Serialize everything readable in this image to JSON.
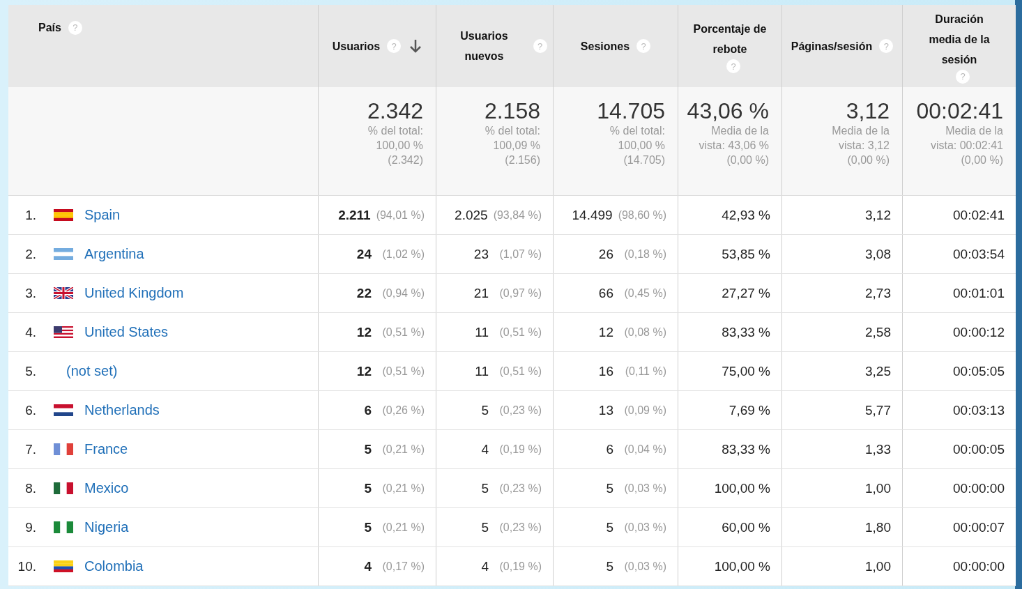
{
  "table": {
    "columns": [
      {
        "label": "País",
        "help": "?"
      },
      {
        "label": "Usuarios",
        "help": "?",
        "sorted": true
      },
      {
        "label": "Usuarios nuevos",
        "help": "?"
      },
      {
        "label": "Sesiones",
        "help": "?"
      },
      {
        "label": "Porcentaje de rebote",
        "help": "?"
      },
      {
        "label": "Páginas/sesión",
        "help": "?"
      },
      {
        "label": "Duración media de la sesión",
        "help": "?"
      }
    ],
    "totals": [
      {
        "value": "2.342",
        "note": [
          "% del total:",
          "100,00 %",
          "(2.342)"
        ]
      },
      {
        "value": "2.158",
        "note": [
          "% del total:",
          "100,09 %",
          "(2.156)"
        ]
      },
      {
        "value": "14.705",
        "note": [
          "% del total:",
          "100,00 %",
          "(14.705)"
        ]
      },
      {
        "value": "43,06 %",
        "note": [
          "Media de la",
          "vista: 43,06 %",
          "(0,00 %)"
        ]
      },
      {
        "value": "3,12",
        "note": [
          "Media de la",
          "vista: 3,12",
          "(0,00 %)"
        ]
      },
      {
        "value": "00:02:41",
        "note": [
          "Media de la",
          "vista: 00:02:41",
          "(0,00 %)"
        ]
      }
    ],
    "rows": [
      {
        "cells": [
          {
            "rank": "1.",
            "country": "Spain",
            "flag": {
              "kind": "es"
            }
          },
          {
            "value": "2.211",
            "share": "(94,01 %)"
          },
          {
            "value": "2.025",
            "share": "(93,84 %)"
          },
          {
            "value": "14.499",
            "share": "(98,60 %)"
          },
          {
            "value": "42,93 %"
          },
          {
            "value": "3,12"
          },
          {
            "value": "00:02:41"
          }
        ]
      },
      {
        "cells": [
          {
            "rank": "2.",
            "country": "Argentina",
            "flag": {
              "kind": "ar"
            }
          },
          {
            "value": "24",
            "share": "(1,02 %)"
          },
          {
            "value": "23",
            "share": "(1,07 %)"
          },
          {
            "value": "26",
            "share": "(0,18 %)"
          },
          {
            "value": "53,85 %"
          },
          {
            "value": "3,08"
          },
          {
            "value": "00:03:54"
          }
        ]
      },
      {
        "cells": [
          {
            "rank": "3.",
            "country": "United Kingdom",
            "flag": {
              "kind": "gb"
            }
          },
          {
            "value": "22",
            "share": "(0,94 %)"
          },
          {
            "value": "21",
            "share": "(0,97 %)"
          },
          {
            "value": "66",
            "share": "(0,45 %)"
          },
          {
            "value": "27,27 %"
          },
          {
            "value": "2,73"
          },
          {
            "value": "00:01:01"
          }
        ]
      },
      {
        "cells": [
          {
            "rank": "4.",
            "country": "United States",
            "flag": {
              "kind": "us"
            }
          },
          {
            "value": "12",
            "share": "(0,51 %)"
          },
          {
            "value": "11",
            "share": "(0,51 %)"
          },
          {
            "value": "12",
            "share": "(0,08 %)"
          },
          {
            "value": "83,33 %"
          },
          {
            "value": "2,58"
          },
          {
            "value": "00:00:12"
          }
        ]
      },
      {
        "cells": [
          {
            "rank": "5.",
            "country": "(not set)"
          },
          {
            "value": "12",
            "share": "(0,51 %)"
          },
          {
            "value": "11",
            "share": "(0,51 %)"
          },
          {
            "value": "16",
            "share": "(0,11 %)"
          },
          {
            "value": "75,00 %"
          },
          {
            "value": "3,25"
          },
          {
            "value": "00:05:05"
          }
        ]
      },
      {
        "cells": [
          {
            "rank": "6.",
            "country": "Netherlands",
            "flag": {
              "kind": "nl"
            }
          },
          {
            "value": "6",
            "share": "(0,26 %)"
          },
          {
            "value": "5",
            "share": "(0,23 %)"
          },
          {
            "value": "13",
            "share": "(0,09 %)"
          },
          {
            "value": "7,69 %"
          },
          {
            "value": "5,77"
          },
          {
            "value": "00:03:13"
          }
        ]
      },
      {
        "cells": [
          {
            "rank": "7.",
            "country": "France",
            "flag": {
              "kind": "fr"
            }
          },
          {
            "value": "5",
            "share": "(0,21 %)"
          },
          {
            "value": "4",
            "share": "(0,19 %)"
          },
          {
            "value": "6",
            "share": "(0,04 %)"
          },
          {
            "value": "83,33 %"
          },
          {
            "value": "1,33"
          },
          {
            "value": "00:00:05"
          }
        ]
      },
      {
        "cells": [
          {
            "rank": "8.",
            "country": "Mexico",
            "flag": {
              "kind": "mx"
            }
          },
          {
            "value": "5",
            "share": "(0,21 %)"
          },
          {
            "value": "5",
            "share": "(0,23 %)"
          },
          {
            "value": "5",
            "share": "(0,03 %)"
          },
          {
            "value": "100,00 %"
          },
          {
            "value": "1,00"
          },
          {
            "value": "00:00:00"
          }
        ]
      },
      {
        "cells": [
          {
            "rank": "9.",
            "country": "Nigeria",
            "flag": {
              "kind": "ng"
            }
          },
          {
            "value": "5",
            "share": "(0,21 %)"
          },
          {
            "value": "5",
            "share": "(0,23 %)"
          },
          {
            "value": "5",
            "share": "(0,03 %)"
          },
          {
            "value": "60,00 %"
          },
          {
            "value": "1,80"
          },
          {
            "value": "00:00:07"
          }
        ]
      },
      {
        "cells": [
          {
            "rank": "10.",
            "country": "Colombia",
            "flag": {
              "kind": "co"
            }
          },
          {
            "value": "4",
            "share": "(0,17 %)"
          },
          {
            "value": "4",
            "share": "(0,19 %)"
          },
          {
            "value": "5",
            "share": "(0,03 %)"
          },
          {
            "value": "100,00 %"
          },
          {
            "value": "1,00"
          },
          {
            "value": "00:00:00"
          }
        ]
      }
    ]
  }
}
